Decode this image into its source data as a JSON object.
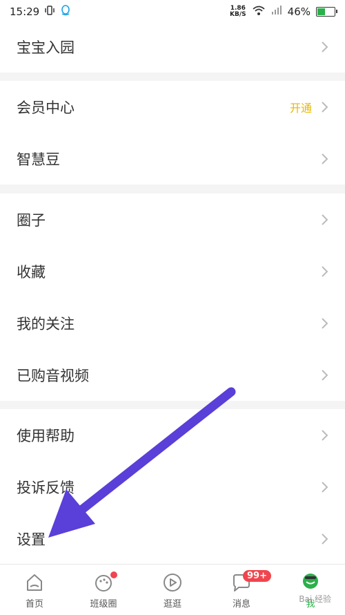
{
  "status_bar": {
    "time": "15:29",
    "speed_value": "1.86",
    "speed_unit": "KB/S",
    "battery": "46%",
    "battery_level": 0.46
  },
  "menu": {
    "group1": [
      {
        "label": "宝宝入园"
      }
    ],
    "group2": [
      {
        "label": "会员中心",
        "extra": "开通"
      },
      {
        "label": "智慧豆"
      }
    ],
    "group3": [
      {
        "label": "圈子"
      },
      {
        "label": "收藏"
      },
      {
        "label": "我的关注"
      },
      {
        "label": "已购音视频"
      }
    ],
    "group4": [
      {
        "label": "使用帮助"
      },
      {
        "label": "投诉反馈"
      },
      {
        "label": "设置"
      }
    ]
  },
  "tabbar": {
    "tabs": [
      {
        "label": "首页"
      },
      {
        "label": "班级圈"
      },
      {
        "label": "逛逛"
      },
      {
        "label": "消息",
        "badge": "99+"
      },
      {
        "label": "我"
      }
    ]
  },
  "watermark": "Bai 经验",
  "colors": {
    "accent": "#2bb04a",
    "badge": "#f0454e",
    "open": "#e6b800",
    "arrow": "#5a3fd8"
  }
}
